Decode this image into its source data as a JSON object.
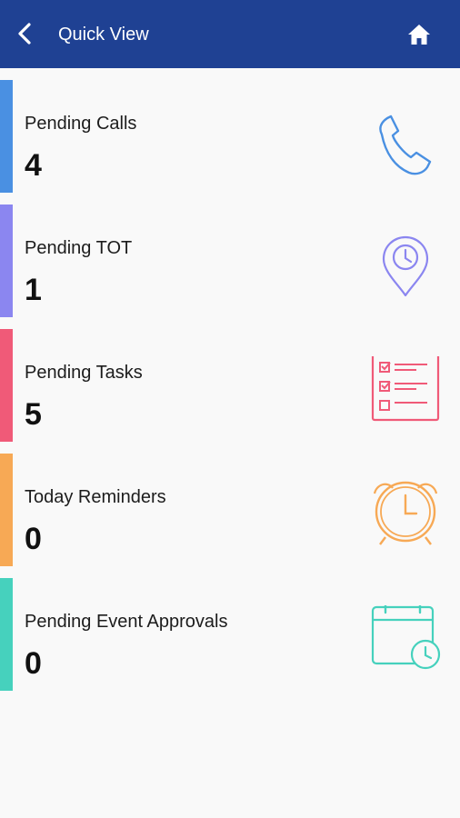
{
  "header": {
    "title": "Quick View",
    "back_icon": "chevron-left-icon",
    "home_icon": "home-icon",
    "background": "#1f4193"
  },
  "cards": [
    {
      "label": "Pending Calls",
      "count": "4",
      "icon": "phone-icon",
      "color": "#4a90e2"
    },
    {
      "label": "Pending TOT",
      "count": "1",
      "icon": "location-clock-icon",
      "color": "#8b86f0"
    },
    {
      "label": "Pending Tasks",
      "count": "5",
      "icon": "checklist-icon",
      "color": "#f05a78"
    },
    {
      "label": "Today Reminders",
      "count": "0",
      "icon": "alarm-clock-icon",
      "color": "#f7a955"
    },
    {
      "label": "Pending Event Approvals",
      "count": "0",
      "icon": "calendar-clock-icon",
      "color": "#46d1bd"
    }
  ]
}
